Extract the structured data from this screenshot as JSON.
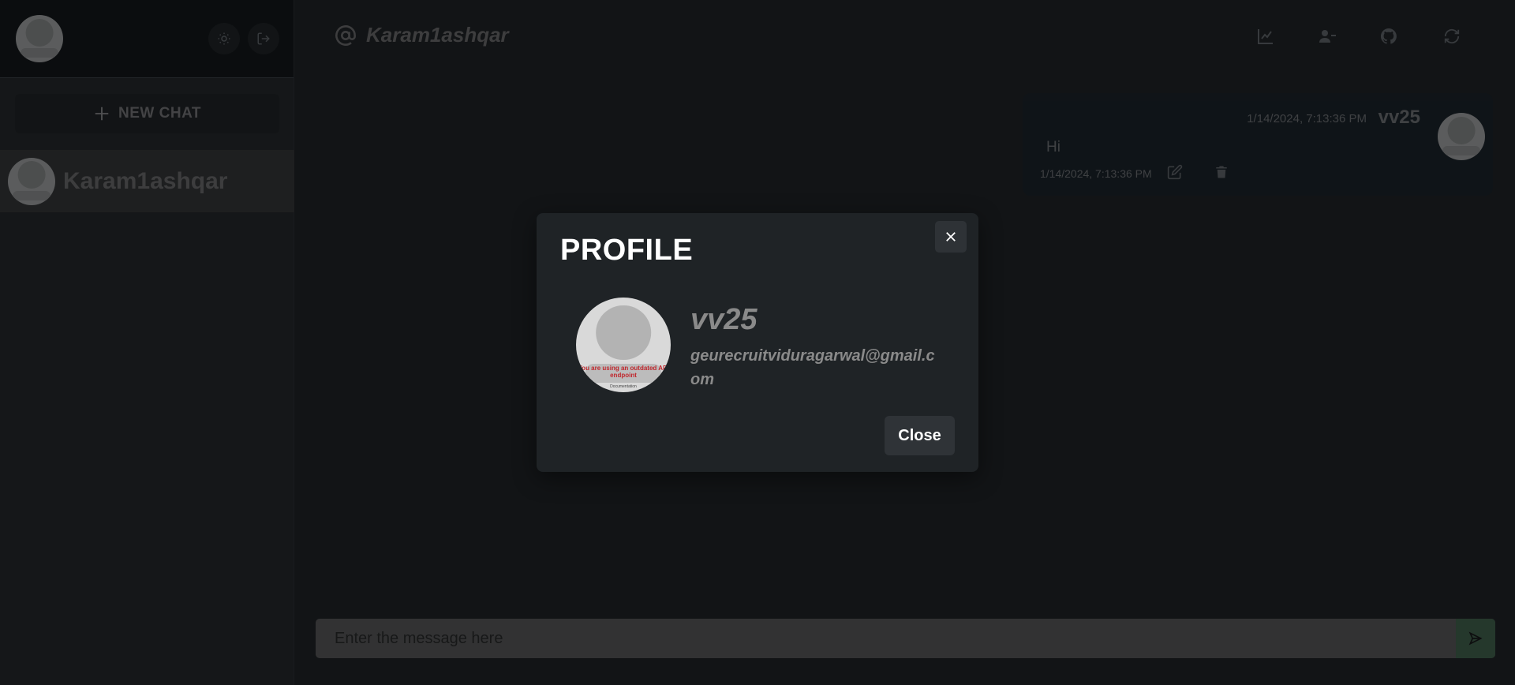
{
  "sidebar": {
    "new_chat_label": "NEW CHAT",
    "contacts": [
      {
        "name": "Karam1ashqar"
      }
    ]
  },
  "avatar_placeholder": {
    "banner_text": "You are using an outdated API endpoint",
    "banner_sub": "Documentation"
  },
  "header": {
    "chat_name": "Karam1ashqar",
    "icons": [
      "chart-icon",
      "user-minus-icon",
      "github-icon",
      "refresh-icon"
    ]
  },
  "messages": [
    {
      "sender": "vv25",
      "timestamp": "1/14/2024, 7:13:36 PM",
      "text": "Hi",
      "footer_timestamp": "1/14/2024, 7:13:36 PM"
    }
  ],
  "composer": {
    "placeholder": "Enter the message here"
  },
  "modal": {
    "title": "PROFILE",
    "name": "vv25",
    "email": "geurecruitviduragarwal@gmail.com",
    "close_label": "Close"
  },
  "colors": {
    "background": "#1c1f22",
    "send_button": "#4f7b5b",
    "modal_bg": "#1f2326"
  }
}
